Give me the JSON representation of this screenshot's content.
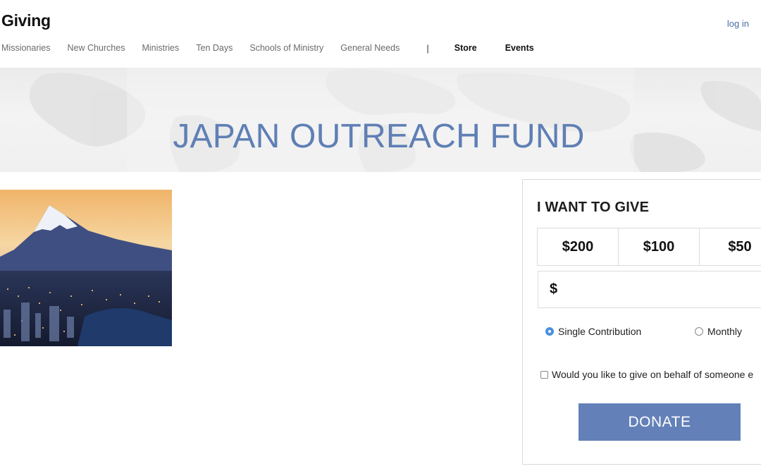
{
  "header": {
    "brand": "Giving",
    "login_label": "log in"
  },
  "nav": {
    "items": [
      {
        "label": "Missionaries"
      },
      {
        "label": "New Churches"
      },
      {
        "label": "Ministries"
      },
      {
        "label": "Ten Days"
      },
      {
        "label": "Schools of Ministry"
      },
      {
        "label": "General Needs"
      }
    ],
    "separator": "|",
    "strong_items": [
      {
        "label": "Store"
      },
      {
        "label": "Events"
      }
    ]
  },
  "hero": {
    "title": "JAPAN OUTREACH FUND"
  },
  "give_panel": {
    "title": "I WANT TO GIVE",
    "amounts": [
      {
        "label": "$200"
      },
      {
        "label": "$100"
      },
      {
        "label": "$50"
      }
    ],
    "currency_symbol": "$",
    "custom_amount_value": "",
    "frequency": {
      "options": [
        {
          "label": "Single Contribution",
          "selected": true
        },
        {
          "label": "Monthly",
          "selected": false
        }
      ]
    },
    "on_behalf_label": "Would you like to give on behalf of someone e",
    "on_behalf_checked": false,
    "donate_label": "DONATE"
  },
  "colors": {
    "accent": "#5f7fb5",
    "donate_bg": "#6381b8",
    "link": "#4a6fa5",
    "radio_selected": "#4a90e2"
  }
}
